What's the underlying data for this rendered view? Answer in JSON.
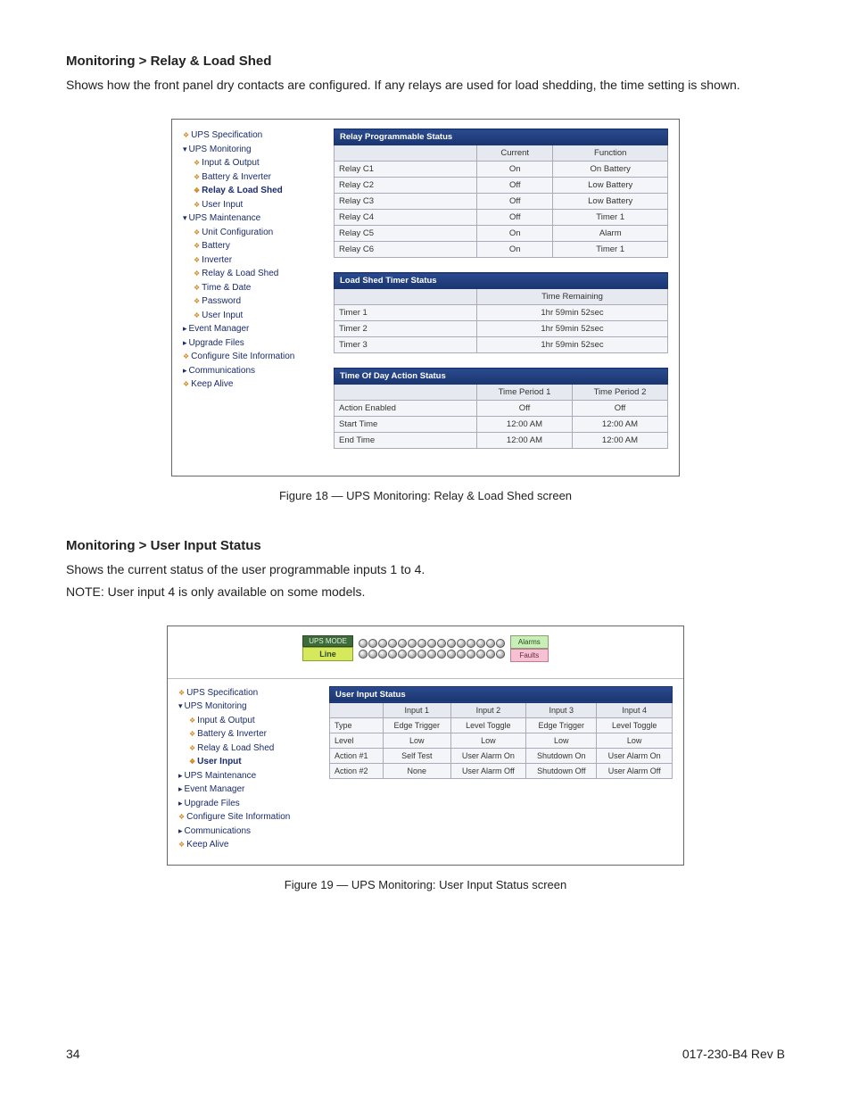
{
  "section1": {
    "heading": "Monitoring > Relay & Load Shed",
    "para": "Shows how the front panel dry contacts are configured. If any relays are used for load shedding, the time setting is shown.",
    "caption": "Figure 18  —  UPS Monitoring: Relay & Load Shed screen"
  },
  "section2": {
    "heading": "Monitoring > User Input Status",
    "para1": "Shows the current status of the user programmable inputs 1 to 4.",
    "para2": "NOTE: User input 4 is only available on some models.",
    "caption": "Figure 19  —  UPS Monitoring: User Input Status screen"
  },
  "nav1": [
    {
      "t": "bullet",
      "label": "UPS Specification"
    },
    {
      "t": "expand",
      "label": "UPS Monitoring"
    },
    {
      "t": "bullet",
      "label": "Input & Output",
      "i": 1
    },
    {
      "t": "bullet",
      "label": "Battery & Inverter",
      "i": 1
    },
    {
      "t": "bullet",
      "label": "Relay & Load Shed",
      "i": 1,
      "sel": true
    },
    {
      "t": "bullet",
      "label": "User Input",
      "i": 1
    },
    {
      "t": "expand",
      "label": "UPS Maintenance"
    },
    {
      "t": "bullet",
      "label": "Unit Configuration",
      "i": 1
    },
    {
      "t": "bullet",
      "label": "Battery",
      "i": 1
    },
    {
      "t": "bullet",
      "label": "Inverter",
      "i": 1
    },
    {
      "t": "bullet",
      "label": "Relay & Load Shed",
      "i": 1
    },
    {
      "t": "bullet",
      "label": "Time & Date",
      "i": 1
    },
    {
      "t": "bullet",
      "label": "Password",
      "i": 1
    },
    {
      "t": "bullet",
      "label": "User Input",
      "i": 1
    },
    {
      "t": "collapsed",
      "label": "Event Manager"
    },
    {
      "t": "collapsed",
      "label": "Upgrade Files"
    },
    {
      "t": "bullet",
      "label": "Configure Site Information"
    },
    {
      "t": "collapsed",
      "label": "Communications"
    },
    {
      "t": "bullet",
      "label": "Keep Alive"
    }
  ],
  "nav2": [
    {
      "t": "bullet",
      "label": "UPS Specification"
    },
    {
      "t": "expand",
      "label": "UPS Monitoring"
    },
    {
      "t": "bullet",
      "label": "Input & Output",
      "i": 1
    },
    {
      "t": "bullet",
      "label": "Battery & Inverter",
      "i": 1
    },
    {
      "t": "bullet",
      "label": "Relay & Load Shed",
      "i": 1
    },
    {
      "t": "bullet",
      "label": "User Input",
      "i": 1,
      "sel": true
    },
    {
      "t": "collapsed",
      "label": "UPS Maintenance"
    },
    {
      "t": "collapsed",
      "label": "Event Manager"
    },
    {
      "t": "collapsed",
      "label": "Upgrade Files"
    },
    {
      "t": "bullet",
      "label": "Configure Site Information"
    },
    {
      "t": "collapsed",
      "label": "Communications"
    },
    {
      "t": "bullet",
      "label": "Keep Alive"
    }
  ],
  "relay_table": {
    "title": "Relay Programmable Status",
    "headers": [
      "",
      "Current",
      "Function"
    ],
    "rows": [
      [
        "Relay C1",
        "On",
        "On Battery"
      ],
      [
        "Relay C2",
        "Off",
        "Low Battery"
      ],
      [
        "Relay C3",
        "Off",
        "Low Battery"
      ],
      [
        "Relay C4",
        "Off",
        "Timer 1"
      ],
      [
        "Relay C5",
        "On",
        "Alarm"
      ],
      [
        "Relay C6",
        "On",
        "Timer 1"
      ]
    ]
  },
  "load_shed_table": {
    "title": "Load Shed Timer Status",
    "header_span": "Time Remaining",
    "rows": [
      [
        "Timer 1",
        "1hr 59min 52sec"
      ],
      [
        "Timer 2",
        "1hr 59min 52sec"
      ],
      [
        "Timer 3",
        "1hr 59min 52sec"
      ]
    ]
  },
  "tod_table": {
    "title": "Time Of Day Action Status",
    "headers": [
      "",
      "Time Period 1",
      "Time Period 2"
    ],
    "rows": [
      [
        "Action Enabled",
        "Off",
        "Off"
      ],
      [
        "Start Time",
        "12:00 AM",
        "12:00 AM"
      ],
      [
        "End Time",
        "12:00 AM",
        "12:00 AM"
      ]
    ]
  },
  "topbar": {
    "mode_label": "UPS MODE",
    "mode_value": "Line",
    "alarms": "Alarms",
    "faults": "Faults"
  },
  "uis_table": {
    "title": "User Input Status",
    "headers": [
      "",
      "Input 1",
      "Input 2",
      "Input 3",
      "Input 4"
    ],
    "rows": [
      [
        "Type",
        "Edge Trigger",
        "Level Toggle",
        "Edge Trigger",
        "Level Toggle"
      ],
      [
        "Level",
        "Low",
        "Low",
        "Low",
        "Low"
      ],
      [
        "Action #1",
        "Self Test",
        "User Alarm On",
        "Shutdown On",
        "User Alarm On"
      ],
      [
        "Action #2",
        "None",
        "User Alarm Off",
        "Shutdown Off",
        "User Alarm Off"
      ]
    ]
  },
  "footer": {
    "page": "34",
    "doc": "017-230-B4    Rev B"
  }
}
